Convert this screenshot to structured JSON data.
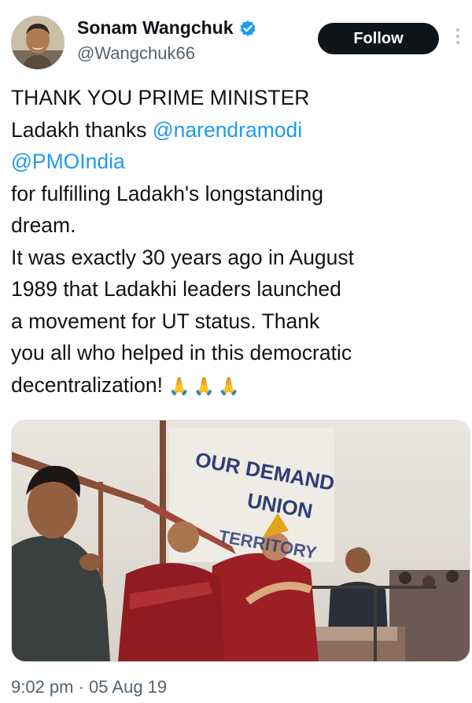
{
  "user": {
    "display_name": "Sonam Wangchuk",
    "handle": "@Wangchuk66",
    "verified": true,
    "avatar": "profile-photo"
  },
  "actions": {
    "follow_label": "Follow",
    "more_icon": "more-vertical-icon"
  },
  "tweet": {
    "line1": "THANK YOU PRIME MINISTER",
    "line2_prefix": "Ladakh thanks ",
    "mention1": "@narendramodi",
    "mention2": "@PMOIndia",
    "line4": "for fulfilling Ladakh's longstanding",
    "line5": "dream.",
    "line6": "It was exactly 30 years ago in August",
    "line7": "1989 that Ladakhi leaders launched",
    "line8": "a movement for UT status. Thank",
    "line9": "you all who helped in this democratic",
    "line10": "decentralization!",
    "emoji": "🙏🙏🙏"
  },
  "media": {
    "banner_line1": "OUR DEMAND",
    "banner_line2": "UNION",
    "banner_line3": "TERRITORY"
  },
  "meta": {
    "timestamp": "9:02 pm · 05 Aug 19"
  },
  "colors": {
    "accent": "#1d9bf0",
    "text": "#0f1419",
    "muted": "#536471"
  }
}
